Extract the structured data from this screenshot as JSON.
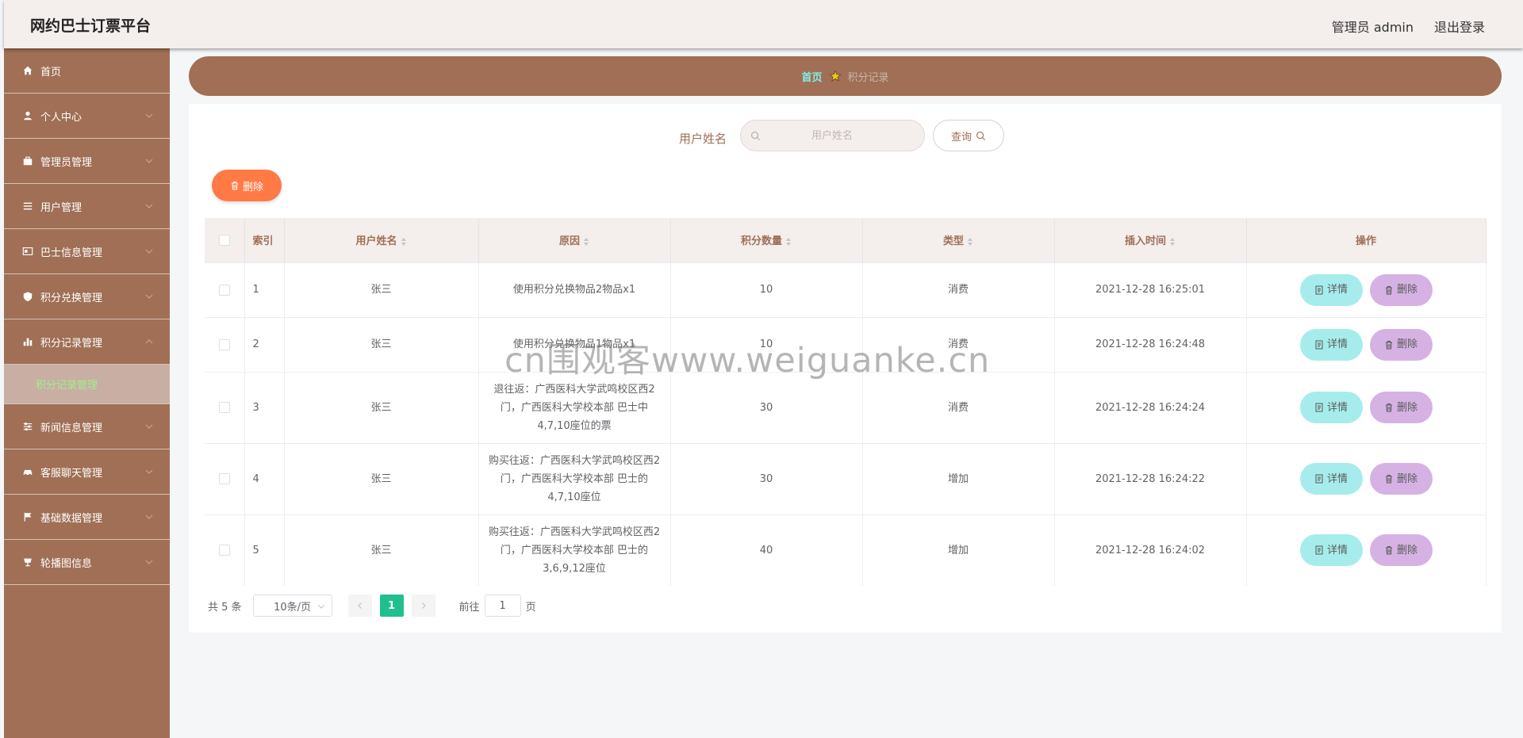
{
  "header": {
    "title": "网约巴士订票平台",
    "admin_label": "管理员 admin",
    "logout_label": "退出登录"
  },
  "sidebar": {
    "items": [
      {
        "label": "首页",
        "icon": "home-icon"
      },
      {
        "label": "个人中心",
        "icon": "user-icon"
      },
      {
        "label": "管理员管理",
        "icon": "briefcase-icon"
      },
      {
        "label": "用户管理",
        "icon": "list-icon"
      },
      {
        "label": "巴士信息管理",
        "icon": "id-card-icon"
      },
      {
        "label": "积分兑换管理",
        "icon": "shield-icon"
      },
      {
        "label": "积分记录管理",
        "icon": "bar-chart-icon"
      },
      {
        "label": "新闻信息管理",
        "icon": "sliders-icon"
      },
      {
        "label": "客服聊天管理",
        "icon": "car-icon"
      },
      {
        "label": "基础数据管理",
        "icon": "flag-icon"
      },
      {
        "label": "轮播图信息",
        "icon": "cup-icon"
      }
    ],
    "active_sub": "积分记录管理"
  },
  "breadcrumb": {
    "home": "首页",
    "current": "积分记录"
  },
  "search": {
    "label": "用户姓名",
    "placeholder": "用户姓名",
    "button": "查询"
  },
  "bulk_delete_label": "删除",
  "table": {
    "columns": [
      "索引",
      "用户姓名",
      "原因",
      "积分数量",
      "类型",
      "插入时间",
      "操作"
    ],
    "rows": [
      {
        "index": "1",
        "name": "张三",
        "reason": "使用积分兑换物品2物品x1",
        "points": "10",
        "type": "消费",
        "time": "2021-12-28 16:25:01"
      },
      {
        "index": "2",
        "name": "张三",
        "reason": "使用积分兑换物品1物品x1",
        "points": "10",
        "type": "消费",
        "time": "2021-12-28 16:24:48"
      },
      {
        "index": "3",
        "name": "张三",
        "reason": "退往返：广西医科大学武鸣校区西2门，广西医科大学校本部 巴士中4,7,10座位的票",
        "points": "30",
        "type": "消费",
        "time": "2021-12-28 16:24:24"
      },
      {
        "index": "4",
        "name": "张三",
        "reason": "购买往返：广西医科大学武鸣校区西2门，广西医科大学校本部 巴士的4,7,10座位",
        "points": "30",
        "type": "增加",
        "time": "2021-12-28 16:24:22"
      },
      {
        "index": "5",
        "name": "张三",
        "reason": "购买往返：广西医科大学武鸣校区西2门，广西医科大学校本部 巴士的3,6,9,12座位",
        "points": "40",
        "type": "增加",
        "time": "2021-12-28 16:24:02"
      }
    ],
    "detail_label": "详情",
    "delete_label": "删除"
  },
  "pagination": {
    "total": "共 5 条",
    "page_size": "10条/页",
    "current_page": "1",
    "goto_prefix": "前往",
    "goto_value": "1",
    "goto_suffix": "页"
  },
  "watermark": "cn围观客www.weiguanke.cn",
  "colors": {
    "brand": "#a06f55",
    "header_bg": "#f4eeed",
    "accent_orange": "#ff7a45",
    "detail_btn": "#a7ecec",
    "delete_btn": "#d5b2e3",
    "page_active": "#20c08e"
  }
}
